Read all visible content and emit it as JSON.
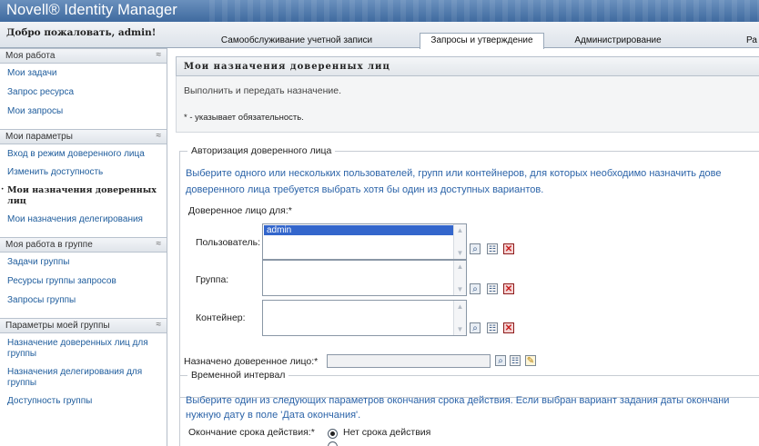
{
  "app": {
    "title": "Novell® Identity Manager"
  },
  "header": {
    "welcome": "Добро пожаловать, admin!"
  },
  "top_tabs": [
    {
      "label": "Самообслуживание учетной записи",
      "active": false
    },
    {
      "label": "Запросы и утверждение",
      "active": true
    },
    {
      "label": "Администрирование",
      "active": false
    },
    {
      "label": "Ра",
      "active": false
    }
  ],
  "sidebar": {
    "sections": [
      {
        "title": "Моя работа",
        "items": [
          "Мои задачи",
          "Запрос ресурса",
          "Мои запросы"
        ]
      },
      {
        "title": "Мои параметры",
        "items": [
          "Вход в режим доверенного лица",
          "Изменить доступность",
          "Мои назначения доверенных лиц",
          "Мои назначения делегирования"
        ],
        "current_index": 2
      },
      {
        "title": "Моя работа в группе",
        "items": [
          "Задачи группы",
          "Ресурсы группы запросов",
          "Запросы группы"
        ]
      },
      {
        "title": "Параметры моей группы",
        "items": [
          "Назначение доверенных лиц для группы",
          "Назначения делегирования для группы",
          "Доступность группы"
        ]
      }
    ],
    "collapse_glyph": "≈"
  },
  "main": {
    "page_title": "Мои назначения доверенных лиц",
    "intro": "Выполнить и передать назначение.",
    "required_note": "* - указывает обязательность.",
    "proxy_auth": {
      "legend": "Авторизация доверенного лица",
      "description_line1": "Выберите одного или нескольких пользователей, групп или контейнеров, для которых необходимо назначить дове",
      "description_line2": "доверенного лица требуется выбрать хотя бы один из доступных вариантов.",
      "proxy_for_label": "Доверенное лицо для:*",
      "user_label": "Пользователь:",
      "user_selected": "admin",
      "group_label": "Группа:",
      "container_label": "Контейнер:"
    },
    "assigned_proxy_label": "Назначено доверенное лицо:*",
    "time_interval": {
      "legend": "Временной интервал",
      "description_line1": "Выберите один из следующих параметров окончания срока действия. Если выбран вариант задания даты окончани",
      "description_line2": "нужную дату в поле 'Дата окончания'.",
      "expiration_label": "Окончание срока действия:*",
      "option_no_expiry": "Нет срока действия"
    }
  },
  "colors": {
    "link": "#1e5c9c",
    "description": "#2b63a8",
    "header": "#3f6a9f"
  }
}
